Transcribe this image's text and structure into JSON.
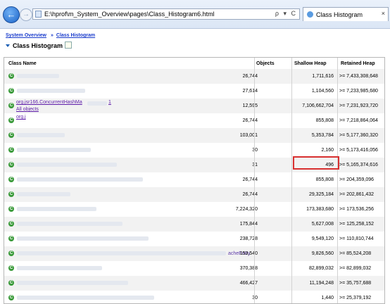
{
  "browser": {
    "address": "E:\\hprof\\m_System_Overview\\pages\\Class_Histogram6.html",
    "address_tools": "ρ ▾ C",
    "tab_title": "Class Histogram",
    "tab_close": "×",
    "back_glyph": "←",
    "forward_glyph": "→"
  },
  "breadcrumb": {
    "root": "System Overview",
    "sep": "»",
    "current": "Class Histogram"
  },
  "section_title": "Class Histogram",
  "table": {
    "headers": {
      "name": "Class Name",
      "objects": "Objects",
      "shallow": "Shallow Heap",
      "retained": "Retained Heap"
    },
    "rows": [
      {
        "objects": "26,744",
        "shallow": "1,711,616",
        "retained": ">= 7,433,308,648"
      },
      {
        "objects": "27,614",
        "shallow": "1,104,560",
        "retained": ">= 7,233,985,680"
      },
      {
        "name": "org.jsr166.ConcurrentHashMa",
        "name_tail": "1",
        "sub": "All objects",
        "objects": "12,595",
        "shallow": "7,106,662,704",
        "retained": ">= 7,231,923,720"
      },
      {
        "name": "org.j",
        "objects": "26,744",
        "shallow": "855,808",
        "retained": ">= 7,218,864,064"
      },
      {
        "objects": "103,001",
        "shallow": "5,353,784",
        "retained": ">= 5,177,360,320"
      },
      {
        "objects": "30",
        "shallow": "2,160",
        "retained": ">= 5,173,416,056"
      },
      {
        "objects": "31",
        "shallow": "496",
        "retained": ">= 5,165,374,616"
      },
      {
        "objects": "26,744",
        "shallow": "855,808",
        "retained": ">= 204,359,096"
      },
      {
        "objects": "26,744",
        "shallow": "29,325,184",
        "retained": ">= 202,861,432"
      },
      {
        "objects": "7,224,320",
        "shallow": "173,383,680",
        "retained": ">= 173,536,256"
      },
      {
        "objects": "175,844",
        "shallow": "5,627,008",
        "retained": ">= 125,258,152"
      },
      {
        "objects": "238,728",
        "shallow": "9,549,120",
        "retained": ">= 110,810,744"
      },
      {
        "bleed": "acheEntry",
        "objects": "153,540",
        "shallow": "9,826,560",
        "retained": ">= 85,524,208"
      },
      {
        "objects": "370,388",
        "shallow": "82,899,032",
        "retained": ">= 82,899,032"
      },
      {
        "objects": "466,427",
        "shallow": "11,194,248",
        "retained": ">= 35,757,688"
      },
      {
        "objects": "30",
        "shallow": "1,440",
        "retained": ">= 25,379,192"
      }
    ]
  },
  "colors": {
    "link": "#1a3ccc",
    "visited": "#5c1aa8",
    "highlight": "#d83030",
    "class_icon": "#3a9a3a"
  }
}
